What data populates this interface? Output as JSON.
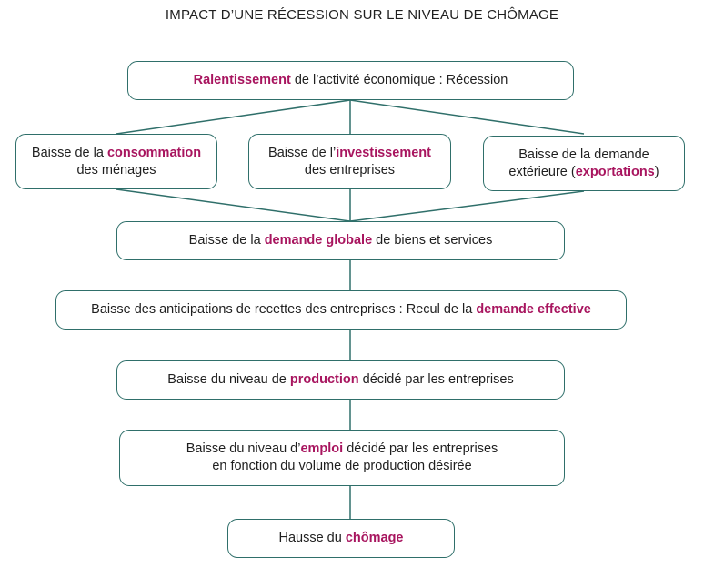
{
  "title": "IMPACT D’UNE RÉCESSION SUR LE NIVEAU DE CHÔMAGE",
  "colors": {
    "border": "#2f6f6a",
    "highlight": "#a8155f",
    "text": "#1f1f1f"
  },
  "boxes": {
    "recession": {
      "lines": [
        [
          {
            "text": "Ralentissement",
            "hl": true
          },
          {
            "text": " de l’activité économique : Récession",
            "hl": false
          }
        ]
      ]
    },
    "consommation": {
      "lines": [
        [
          {
            "text": "Baisse de la ",
            "hl": false
          },
          {
            "text": "consommation",
            "hl": true
          }
        ],
        [
          {
            "text": "des ménages",
            "hl": false
          }
        ]
      ]
    },
    "investissement": {
      "lines": [
        [
          {
            "text": "Baisse de l’",
            "hl": false
          },
          {
            "text": "investissement",
            "hl": true
          }
        ],
        [
          {
            "text": "des entreprises",
            "hl": false
          }
        ]
      ]
    },
    "exterieure": {
      "lines": [
        [
          {
            "text": "Baisse de la demande",
            "hl": false
          }
        ],
        [
          {
            "text": "extérieure (",
            "hl": false
          },
          {
            "text": "exportations",
            "hl": true
          },
          {
            "text": ")",
            "hl": false
          }
        ]
      ]
    },
    "demande_globale": {
      "lines": [
        [
          {
            "text": "Baisse de la ",
            "hl": false
          },
          {
            "text": "demande globale",
            "hl": true
          },
          {
            "text": " de biens et services",
            "hl": false
          }
        ]
      ]
    },
    "anticipations": {
      "lines": [
        [
          {
            "text": "Baisse des anticipations de recettes des entreprises : Recul de la ",
            "hl": false
          },
          {
            "text": "demande effective",
            "hl": true
          }
        ]
      ]
    },
    "production": {
      "lines": [
        [
          {
            "text": "Baisse du niveau de ",
            "hl": false
          },
          {
            "text": "production",
            "hl": true
          },
          {
            "text": " décidé par les entreprises",
            "hl": false
          }
        ]
      ]
    },
    "emploi": {
      "lines": [
        [
          {
            "text": "Baisse du niveau d’",
            "hl": false
          },
          {
            "text": "emploi",
            "hl": true
          },
          {
            "text": " décidé par les entreprises",
            "hl": false
          }
        ],
        [
          {
            "text": "en fonction du volume de production désirée",
            "hl": false
          }
        ]
      ]
    },
    "chomage": {
      "lines": [
        [
          {
            "text": "Hausse du ",
            "hl": false
          },
          {
            "text": "chômage",
            "hl": true
          }
        ]
      ]
    }
  }
}
